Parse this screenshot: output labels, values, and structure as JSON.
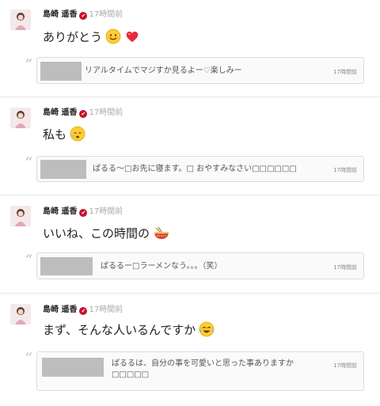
{
  "posts": [
    {
      "author": "島崎 遥香",
      "verified_mark": "✔",
      "time": "17時間前",
      "message": "ありがとう",
      "emojis": [
        "smiling-face-icon",
        "red-heart-icon"
      ],
      "quote": {
        "text": "リアルタイムでマジすか見るよー♡楽しみー",
        "time": "17時間前"
      }
    },
    {
      "author": "島崎 遥香",
      "verified_mark": "✔",
      "time": "17時間前",
      "message": "私も",
      "emojis": [
        "sleepy-face-icon"
      ],
      "quote": {
        "text": "ぱるる～□お先に寝ます。□ おやすみなさい□□□□□□",
        "time": "17時間前"
      }
    },
    {
      "author": "島崎 遥香",
      "verified_mark": "✔",
      "time": "17時間前",
      "message": "いいね、この時間の",
      "emojis": [
        "ramen-bowl-icon"
      ],
      "quote": {
        "text": "ぱるるー□ラーメンなう。。。（笑）",
        "time": "17時間前"
      }
    },
    {
      "author": "島崎 遥香",
      "verified_mark": "✔",
      "time": "17時間前",
      "message": "まず、そんな人いるんですか",
      "emojis": [
        "tears-of-joy-icon"
      ],
      "quote": {
        "text": "ぱるるは、自分の事を可愛いと思った事ありますか□□□□□",
        "time": "17時間前"
      }
    }
  ],
  "colors": {
    "verified": "#c8102e",
    "timestamp": "#aaaaaa",
    "quote_border": "#dcdcdc",
    "thumb": "#bdbdbd"
  }
}
